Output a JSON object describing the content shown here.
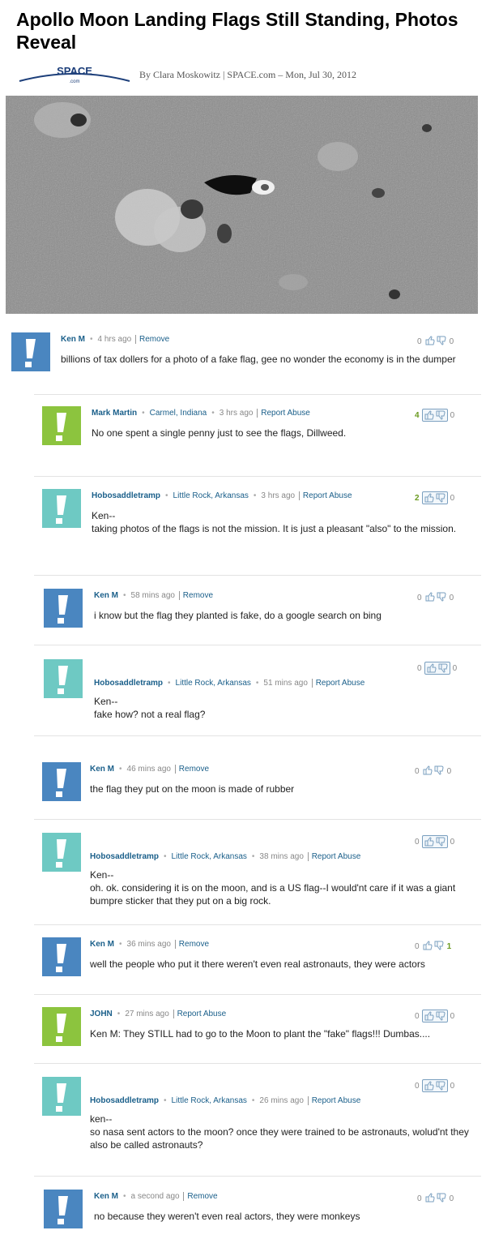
{
  "article": {
    "title": "Apollo Moon Landing Flags Still Standing, Photos Reveal",
    "byline": "By Clara Moskowitz | SPACE.com – Mon, Jul 30, 2012",
    "logo_text": "SPACE",
    "logo_sub": ".com"
  },
  "colors": {
    "blue_avatar": "#4a86c0",
    "green_avatar": "#8cc43e",
    "teal_avatar": "#6ec9c3",
    "link": "#1a5f8a"
  },
  "comments": [
    {
      "user": "Ken M",
      "location": "",
      "time": "4 hrs ago",
      "action": "Remove",
      "text": "billions of tax dollers for a photo of a fake flag, gee no wonder the economy is in the dumper",
      "up": "0",
      "down": "0",
      "avatar": "blue"
    },
    {
      "user": "Mark Martin",
      "location": "Carmel, Indiana",
      "time": "3 hrs ago",
      "action": "Report Abuse",
      "text": "No one spent a single penny just to see the flags, Dillweed.",
      "up": "4",
      "down": "0",
      "avatar": "green"
    },
    {
      "user": "Hobosaddletramp",
      "location": "Little Rock, Arkansas",
      "time": "3 hrs ago",
      "action": "Report Abuse",
      "text": "Ken--\ntaking photos of the flags is not the mission. It is just a pleasant \"also\" to the mission.",
      "up": "2",
      "down": "0",
      "avatar": "teal"
    },
    {
      "user": "Ken M",
      "location": "",
      "time": "58 mins ago",
      "action": "Remove",
      "text": "i know but the flag they planted is fake, do a google search on bing",
      "up": "0",
      "down": "0",
      "avatar": "blue"
    },
    {
      "user": "Hobosaddletramp",
      "location": "Little Rock, Arkansas",
      "time": "51 mins ago",
      "action": "Report Abuse",
      "text": "Ken--\nfake how? not a real flag?",
      "up": "0",
      "down": "0",
      "avatar": "teal"
    },
    {
      "user": "Ken M",
      "location": "",
      "time": "46 mins ago",
      "action": "Remove",
      "text": "the flag they put on the moon is made of rubber",
      "up": "0",
      "down": "0",
      "avatar": "blue"
    },
    {
      "user": "Hobosaddletramp",
      "location": "Little Rock, Arkansas",
      "time": "38 mins ago",
      "action": "Report Abuse",
      "text": "Ken--\noh. ok. considering it is on the moon, and is a US flag--I would'nt care if it was a giant bumpre sticker that they put on a big rock.",
      "up": "0",
      "down": "0",
      "avatar": "teal"
    },
    {
      "user": "Ken M",
      "location": "",
      "time": "36 mins ago",
      "action": "Remove",
      "text": "well the people who put it there weren't even real astronauts, they were actors",
      "up": "0",
      "down": "1",
      "avatar": "blue"
    },
    {
      "user": "JOHN",
      "location": "",
      "time": "27 mins ago",
      "action": "Report Abuse",
      "text": "Ken M: They STILL had to go to the Moon to plant the \"fake\" flags!!! Dumbas....",
      "up": "0",
      "down": "0",
      "avatar": "green"
    },
    {
      "user": "Hobosaddletramp",
      "location": "Little Rock, Arkansas",
      "time": "26 mins ago",
      "action": "Report Abuse",
      "text": "ken--\nso nasa sent actors to the moon? once they were trained to be astronauts, wolud'nt they also be called astronauts?",
      "up": "0",
      "down": "0",
      "avatar": "teal"
    },
    {
      "user": "Ken M",
      "location": "",
      "time": "a second ago",
      "action": "Remove",
      "text": "no because they weren't even real actors, they were monkeys",
      "up": "0",
      "down": "0",
      "avatar": "blue"
    }
  ]
}
